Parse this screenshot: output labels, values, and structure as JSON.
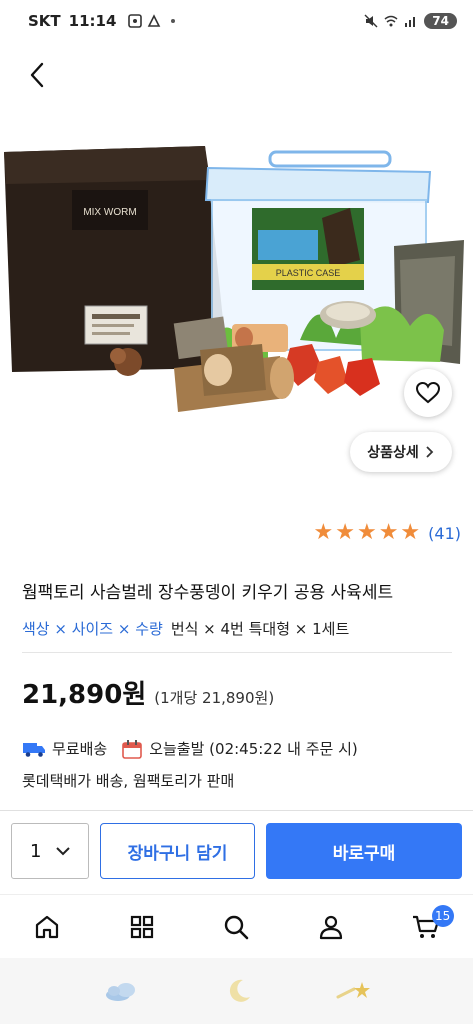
{
  "status_bar": {
    "carrier": "SKT",
    "time": "11:14",
    "battery": "74"
  },
  "product": {
    "rating_count": "(41)",
    "stars": 5,
    "title": "웜팩토리 사슴벌레 장수풍뎅이 키우기 공용 사육세트",
    "option_label": "색상 × 사이즈 × 수량",
    "option_value": "번식 × 4번 특대형 × 1세트",
    "price": "21,890원",
    "unit_price": "(1개당 21,890원)",
    "free_shipping": "무료배송",
    "same_day": "오늘출발 (02:45:22 내 주문 시)",
    "seller_info": "롯데택배가 배송, 웜팩토리가 판매",
    "image_labels": {
      "bag": "MIX WORM",
      "box": "PLASTIC CASE"
    }
  },
  "buttons": {
    "detail": "상품상세",
    "quantity": "1",
    "add_to_cart": "장바구니 담기",
    "buy_now": "바로구매"
  },
  "bottom_nav": {
    "cart_badge": "15"
  },
  "colors": {
    "accent": "#3478f6",
    "star": "#f08c3a",
    "link": "#2b6bd6"
  }
}
